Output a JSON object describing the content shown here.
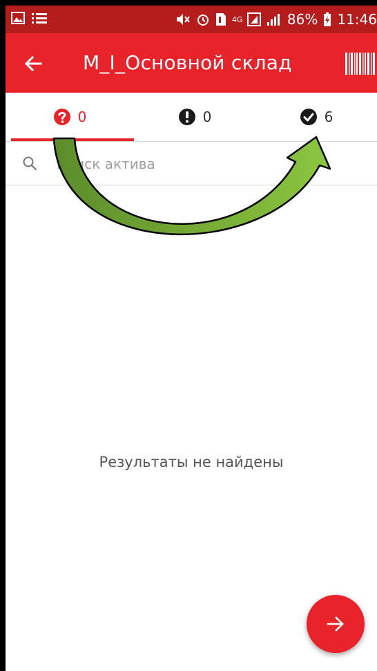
{
  "status_bar": {
    "battery": "86%",
    "time": "11:46",
    "network": "4G"
  },
  "app_bar": {
    "title": "M_I_Основной склад"
  },
  "tabs": [
    {
      "icon": "question-circle-icon",
      "count": "0",
      "active": true
    },
    {
      "icon": "exclamation-circle-icon",
      "count": "0",
      "active": false
    },
    {
      "icon": "check-circle-icon",
      "count": "6",
      "active": false
    }
  ],
  "search": {
    "placeholder": "Поиск актива",
    "value": ""
  },
  "content": {
    "empty_message": "Результаты не найдены"
  },
  "colors": {
    "primary": "#e8232a",
    "status_bar": "#b71c1c",
    "arrow_green_dark": "#5b8c2a",
    "arrow_green_light": "#8cc63f"
  }
}
